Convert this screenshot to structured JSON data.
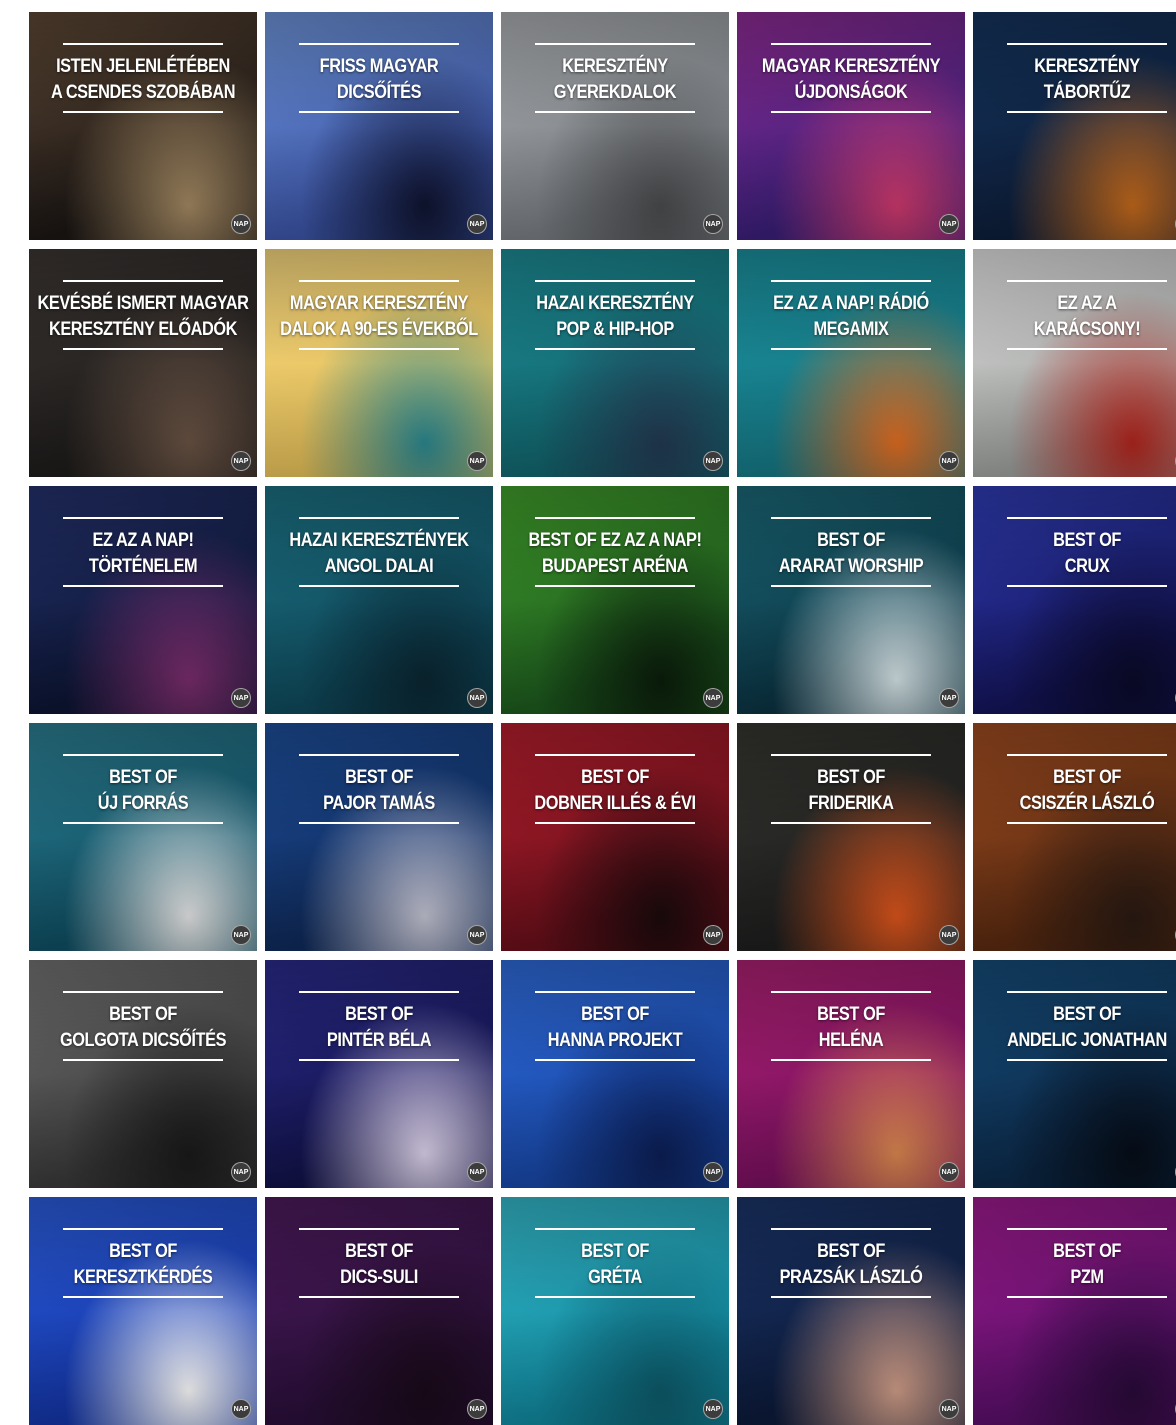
{
  "badge_text": "NAP",
  "playlists": [
    {
      "lines": [
        "ISTEN JELENLÉTÉBEN",
        "A CSENDES SZOBÁBAN"
      ],
      "colors": [
        "#1b1614",
        "#5a4533",
        "#a58a63"
      ]
    },
    {
      "lines": [
        "FRISS MAGYAR",
        "DICSŐÍTÉS"
      ],
      "colors": [
        "#3c55a8",
        "#6a8fd2",
        "#0f1430"
      ]
    },
    {
      "lines": [
        "KERESZTÉNY",
        "GYEREKDALOK"
      ],
      "colors": [
        "#7a7f84",
        "#a6a9ac",
        "#4b4c4e"
      ]
    },
    {
      "lines": [
        "MAGYAR KERESZTÉNY",
        "ÚJDONSÁGOK"
      ],
      "colors": [
        "#3a1f7a",
        "#8a2a8f",
        "#d13a6e"
      ]
    },
    {
      "lines": [
        "KERESZTÉNY",
        "TÁBORTŰZ"
      ],
      "colors": [
        "#0d1e3a",
        "#14325a",
        "#c56a1c"
      ]
    },
    {
      "lines": [
        "KEVÉSBÉ ISMERT MAGYAR",
        "KERESZTÉNY ELŐADÓK"
      ],
      "colors": [
        "#1e1c1b",
        "#3a3431",
        "#6b5445"
      ]
    },
    {
      "lines": [
        "MAGYAR KERESZTÉNY",
        "DALOK A 90-ES ÉVEKBŐL"
      ],
      "colors": [
        "#e8c25a",
        "#f0d27c",
        "#2c8a92"
      ]
    },
    {
      "lines": [
        "HAZAI KERESZTÉNY",
        "POP & HIP-HOP"
      ],
      "colors": [
        "#12676f",
        "#1c8790",
        "#233a52"
      ]
    },
    {
      "lines": [
        "EZ AZ A NAP! RÁDIÓ",
        "MEGAMIX"
      ],
      "colors": [
        "#167a87",
        "#1a8c99",
        "#e56f22"
      ]
    },
    {
      "lines": [
        "EZ AZ A",
        "KARÁCSONY!"
      ],
      "colors": [
        "#9fa29f",
        "#dcdcdc",
        "#b3261e"
      ]
    },
    {
      "lines": [
        "EZ AZ A NAP!",
        "TÖRTÉNELEM"
      ],
      "colors": [
        "#0c1533",
        "#23306a",
        "#7b2d6e"
      ]
    },
    {
      "lines": [
        "HAZAI KERESZTÉNYEK",
        "ANGOL DALAI"
      ],
      "colors": [
        "#0f4a5c",
        "#1b6d7e",
        "#0a2632"
      ]
    },
    {
      "lines": [
        "BEST OF EZ AZ A NAP!",
        "BUDAPEST ARÉNA"
      ],
      "colors": [
        "#1d5a1e",
        "#3f9a2a",
        "#0b1d0b"
      ]
    },
    {
      "lines": [
        "BEST OF",
        "ARARAT WORSHIP"
      ],
      "colors": [
        "#0b3342",
        "#1a6675",
        "#d9e7ea"
      ]
    },
    {
      "lines": [
        "BEST OF",
        "CRUX"
      ],
      "colors": [
        "#14145a",
        "#2e3bb0",
        "#0a0a2a"
      ]
    },
    {
      "lines": [
        "BEST OF",
        "ÚJ FORRÁS"
      ],
      "colors": [
        "#0f4f63",
        "#2b7b8e",
        "#e9e9e9"
      ]
    },
    {
      "lines": [
        "BEST OF",
        "PAJOR TAMÁS"
      ],
      "colors": [
        "#0f2a5a",
        "#1c4c96",
        "#c7c7d6"
      ]
    },
    {
      "lines": [
        "BEST OF",
        "DOBNER ILLÉS & ÉVI"
      ],
      "colors": [
        "#6a0f1a",
        "#b01e2c",
        "#1b0a0c"
      ]
    },
    {
      "lines": [
        "BEST OF",
        "FRIDERIKA"
      ],
      "colors": [
        "#1e1e1e",
        "#33332e",
        "#e0561c"
      ]
    },
    {
      "lines": [
        "BEST OF",
        "CSISZÉR LÁSZLÓ"
      ],
      "colors": [
        "#5a2a10",
        "#9a4a20",
        "#2a1a12"
      ]
    },
    {
      "lines": [
        "BEST OF",
        "GOLGOTA DICSŐÍTÉS"
      ],
      "colors": [
        "#3a3a3a",
        "#6f6f6f",
        "#1a1a1a"
      ]
    },
    {
      "lines": [
        "BEST OF",
        "PINTÉR BÉLA"
      ],
      "colors": [
        "#12124a",
        "#2a2a8a",
        "#e0d6ef"
      ]
    },
    {
      "lines": [
        "BEST OF",
        "HANNA PROJEKT"
      ],
      "colors": [
        "#1848a8",
        "#2e68d4",
        "#0c1f56"
      ]
    },
    {
      "lines": [
        "BEST OF",
        "HELÉNA"
      ],
      "colors": [
        "#7a1060",
        "#a8206f",
        "#e08a50"
      ]
    },
    {
      "lines": [
        "BEST OF",
        "ANDELIC JONATHAN"
      ],
      "colors": [
        "#0c2a4a",
        "#154a76",
        "#060d18"
      ]
    },
    {
      "lines": [
        "BEST OF",
        "KERESZTKÉRDÉS"
      ],
      "colors": [
        "#1436a8",
        "#2a5ad6",
        "#ffffff"
      ]
    },
    {
      "lines": [
        "BEST OF",
        "DICS-SULI"
      ],
      "colors": [
        "#2a0f3a",
        "#4a1a5a",
        "#1a0a1a"
      ]
    },
    {
      "lines": [
        "BEST OF",
        "GRÉTA"
      ],
      "colors": [
        "#118aa0",
        "#33b3c4",
        "#0d5a6a"
      ]
    },
    {
      "lines": [
        "BEST OF",
        "PRAZSÁK LÁSZLÓ"
      ],
      "colors": [
        "#0c1a3a",
        "#1a3366",
        "#d4a08a"
      ]
    },
    {
      "lines": [
        "BEST OF",
        "PZM"
      ],
      "colors": [
        "#5a0f6a",
        "#9a1a8a",
        "#2a0a3a"
      ]
    }
  ]
}
